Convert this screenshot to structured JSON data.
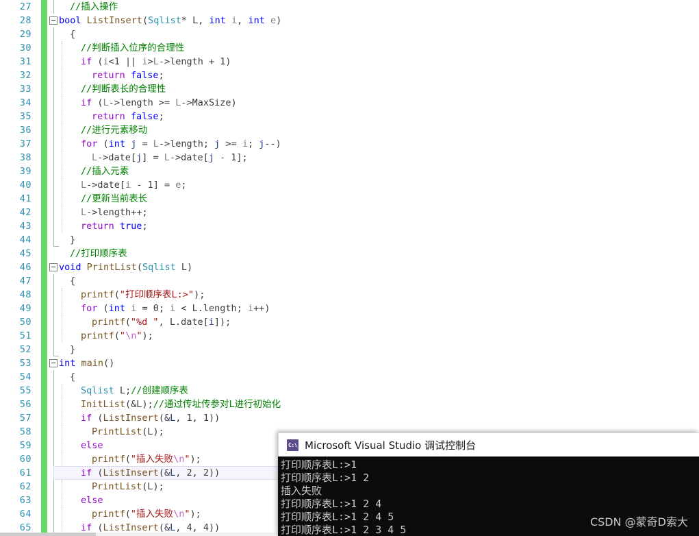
{
  "editor": {
    "first_line_number": 27,
    "current_line_number": 61,
    "colors": {
      "keyword": "#0000ff",
      "control_keyword": "#8f08c4",
      "type": "#2b91af",
      "function": "#74531f",
      "string": "#a31515",
      "escape": "#c660c6",
      "comment": "#008000",
      "line_number": "#2b91af",
      "change_bar": "#69d76a",
      "background": "#ffffff"
    },
    "lines": [
      {
        "n": 27,
        "indent": 1,
        "tokens": [
          {
            "t": "//插入操作",
            "c": "cmt"
          }
        ]
      },
      {
        "n": 28,
        "indent": 0,
        "collapse": true,
        "tokens": [
          {
            "t": "bool",
            "c": "kw"
          },
          {
            "t": " ",
            "c": "plain"
          },
          {
            "t": "ListInsert",
            "c": "fn"
          },
          {
            "t": "(",
            "c": "plain"
          },
          {
            "t": "Sqlist",
            "c": "typ"
          },
          {
            "t": "* L, ",
            "c": "plain"
          },
          {
            "t": "int",
            "c": "kw"
          },
          {
            "t": " ",
            "c": "plain"
          },
          {
            "t": "i",
            "c": "id"
          },
          {
            "t": ", ",
            "c": "plain"
          },
          {
            "t": "int",
            "c": "kw"
          },
          {
            "t": " ",
            "c": "plain"
          },
          {
            "t": "e",
            "c": "id"
          },
          {
            "t": ")",
            "c": "plain"
          }
        ]
      },
      {
        "n": 29,
        "indent": 1,
        "tokens": [
          {
            "t": "{",
            "c": "plain"
          }
        ]
      },
      {
        "n": 30,
        "indent": 2,
        "tokens": [
          {
            "t": "//判断插入位序的合理性",
            "c": "cmt"
          }
        ]
      },
      {
        "n": 31,
        "indent": 2,
        "tokens": [
          {
            "t": "if",
            "c": "kwctl"
          },
          {
            "t": " (",
            "c": "plain"
          },
          {
            "t": "i",
            "c": "id"
          },
          {
            "t": "<1 || ",
            "c": "plain"
          },
          {
            "t": "i",
            "c": "id"
          },
          {
            "t": ">",
            "c": "plain"
          },
          {
            "t": "L",
            "c": "id"
          },
          {
            "t": "->",
            "c": "plain"
          },
          {
            "t": "length",
            "c": "plain"
          },
          {
            "t": " + 1)",
            "c": "plain"
          }
        ]
      },
      {
        "n": 32,
        "indent": 3,
        "tokens": [
          {
            "t": "return",
            "c": "kwctl"
          },
          {
            "t": " ",
            "c": "plain"
          },
          {
            "t": "false",
            "c": "kw"
          },
          {
            "t": ";",
            "c": "plain"
          }
        ]
      },
      {
        "n": 33,
        "indent": 2,
        "tokens": [
          {
            "t": "//判断表长的合理性",
            "c": "cmt"
          }
        ]
      },
      {
        "n": 34,
        "indent": 2,
        "tokens": [
          {
            "t": "if",
            "c": "kwctl"
          },
          {
            "t": " (",
            "c": "plain"
          },
          {
            "t": "L",
            "c": "id"
          },
          {
            "t": "->",
            "c": "plain"
          },
          {
            "t": "length",
            "c": "plain"
          },
          {
            "t": " >= ",
            "c": "plain"
          },
          {
            "t": "L",
            "c": "id"
          },
          {
            "t": "->",
            "c": "plain"
          },
          {
            "t": "MaxSize",
            "c": "plain"
          },
          {
            "t": ")",
            "c": "plain"
          }
        ]
      },
      {
        "n": 35,
        "indent": 3,
        "tokens": [
          {
            "t": "return",
            "c": "kwctl"
          },
          {
            "t": " ",
            "c": "plain"
          },
          {
            "t": "false",
            "c": "kw"
          },
          {
            "t": ";",
            "c": "plain"
          }
        ]
      },
      {
        "n": 36,
        "indent": 2,
        "tokens": [
          {
            "t": "//进行元素移动",
            "c": "cmt"
          }
        ]
      },
      {
        "n": 37,
        "indent": 2,
        "tokens": [
          {
            "t": "for",
            "c": "kwctl"
          },
          {
            "t": " (",
            "c": "plain"
          },
          {
            "t": "int",
            "c": "kw"
          },
          {
            "t": " ",
            "c": "plain"
          },
          {
            "t": "j",
            "c": "idx"
          },
          {
            "t": " = ",
            "c": "plain"
          },
          {
            "t": "L",
            "c": "id"
          },
          {
            "t": "->",
            "c": "plain"
          },
          {
            "t": "length",
            "c": "plain"
          },
          {
            "t": "; ",
            "c": "plain"
          },
          {
            "t": "j",
            "c": "idx"
          },
          {
            "t": " >= ",
            "c": "plain"
          },
          {
            "t": "i",
            "c": "id"
          },
          {
            "t": "; ",
            "c": "plain"
          },
          {
            "t": "j",
            "c": "idx"
          },
          {
            "t": "--)",
            "c": "plain"
          }
        ]
      },
      {
        "n": 38,
        "indent": 3,
        "tokens": [
          {
            "t": "L",
            "c": "id"
          },
          {
            "t": "->",
            "c": "plain"
          },
          {
            "t": "date",
            "c": "plain"
          },
          {
            "t": "[",
            "c": "plain"
          },
          {
            "t": "j",
            "c": "idx"
          },
          {
            "t": "] = ",
            "c": "plain"
          },
          {
            "t": "L",
            "c": "id"
          },
          {
            "t": "->",
            "c": "plain"
          },
          {
            "t": "date",
            "c": "plain"
          },
          {
            "t": "[",
            "c": "plain"
          },
          {
            "t": "j",
            "c": "idx"
          },
          {
            "t": " - 1];",
            "c": "plain"
          }
        ]
      },
      {
        "n": 39,
        "indent": 2,
        "tokens": [
          {
            "t": "//插入元素",
            "c": "cmt"
          }
        ]
      },
      {
        "n": 40,
        "indent": 2,
        "tokens": [
          {
            "t": "L",
            "c": "id"
          },
          {
            "t": "->",
            "c": "plain"
          },
          {
            "t": "date",
            "c": "plain"
          },
          {
            "t": "[",
            "c": "plain"
          },
          {
            "t": "i",
            "c": "id"
          },
          {
            "t": " - 1] = ",
            "c": "plain"
          },
          {
            "t": "e",
            "c": "id"
          },
          {
            "t": ";",
            "c": "plain"
          }
        ]
      },
      {
        "n": 41,
        "indent": 2,
        "tokens": [
          {
            "t": "//更新当前表长",
            "c": "cmt"
          }
        ]
      },
      {
        "n": 42,
        "indent": 2,
        "tokens": [
          {
            "t": "L",
            "c": "id"
          },
          {
            "t": "->",
            "c": "plain"
          },
          {
            "t": "length",
            "c": "plain"
          },
          {
            "t": "++;",
            "c": "plain"
          }
        ]
      },
      {
        "n": 43,
        "indent": 2,
        "tokens": [
          {
            "t": "return",
            "c": "kwctl"
          },
          {
            "t": " ",
            "c": "plain"
          },
          {
            "t": "true",
            "c": "kw"
          },
          {
            "t": ";",
            "c": "plain"
          }
        ]
      },
      {
        "n": 44,
        "indent": 1,
        "tokens": [
          {
            "t": "}",
            "c": "plain"
          }
        ]
      },
      {
        "n": 45,
        "indent": 1,
        "tokens": [
          {
            "t": "//打印顺序表",
            "c": "cmt"
          }
        ]
      },
      {
        "n": 46,
        "indent": 0,
        "collapse": true,
        "tokens": [
          {
            "t": "void",
            "c": "kw"
          },
          {
            "t": " ",
            "c": "plain"
          },
          {
            "t": "PrintList",
            "c": "fn"
          },
          {
            "t": "(",
            "c": "plain"
          },
          {
            "t": "Sqlist",
            "c": "typ"
          },
          {
            "t": " ",
            "c": "plain"
          },
          {
            "t": "L",
            "c": "plain"
          },
          {
            "t": ")",
            "c": "plain"
          }
        ]
      },
      {
        "n": 47,
        "indent": 1,
        "tokens": [
          {
            "t": "{",
            "c": "plain"
          }
        ]
      },
      {
        "n": 48,
        "indent": 2,
        "tokens": [
          {
            "t": "printf",
            "c": "fn"
          },
          {
            "t": "(",
            "c": "plain"
          },
          {
            "t": "\"打印顺序表L:>\"",
            "c": "str"
          },
          {
            "t": ");",
            "c": "plain"
          }
        ]
      },
      {
        "n": 49,
        "indent": 2,
        "tokens": [
          {
            "t": "for",
            "c": "kwctl"
          },
          {
            "t": " (",
            "c": "plain"
          },
          {
            "t": "int",
            "c": "kw"
          },
          {
            "t": " ",
            "c": "plain"
          },
          {
            "t": "i",
            "c": "id"
          },
          {
            "t": " = 0; ",
            "c": "plain"
          },
          {
            "t": "i",
            "c": "id"
          },
          {
            "t": " < ",
            "c": "plain"
          },
          {
            "t": "L",
            "c": "plain"
          },
          {
            "t": ".",
            "c": "plain"
          },
          {
            "t": "length",
            "c": "plain"
          },
          {
            "t": "; ",
            "c": "plain"
          },
          {
            "t": "i",
            "c": "id"
          },
          {
            "t": "++)",
            "c": "plain"
          }
        ]
      },
      {
        "n": 50,
        "indent": 3,
        "tokens": [
          {
            "t": "printf",
            "c": "fn"
          },
          {
            "t": "(",
            "c": "plain"
          },
          {
            "t": "\"%d \"",
            "c": "str"
          },
          {
            "t": ", ",
            "c": "plain"
          },
          {
            "t": "L",
            "c": "plain"
          },
          {
            "t": ".",
            "c": "plain"
          },
          {
            "t": "date",
            "c": "plain"
          },
          {
            "t": "[",
            "c": "plain"
          },
          {
            "t": "i",
            "c": "idx"
          },
          {
            "t": "]);",
            "c": "plain"
          }
        ]
      },
      {
        "n": 51,
        "indent": 2,
        "tokens": [
          {
            "t": "printf",
            "c": "fn"
          },
          {
            "t": "(",
            "c": "plain"
          },
          {
            "t": "\"",
            "c": "str"
          },
          {
            "t": "\\n",
            "c": "esc"
          },
          {
            "t": "\"",
            "c": "str"
          },
          {
            "t": ");",
            "c": "plain"
          }
        ]
      },
      {
        "n": 52,
        "indent": 1,
        "tokens": [
          {
            "t": "}",
            "c": "plain"
          }
        ]
      },
      {
        "n": 53,
        "indent": 0,
        "collapse": true,
        "tokens": [
          {
            "t": "int",
            "c": "kw"
          },
          {
            "t": " ",
            "c": "plain"
          },
          {
            "t": "main",
            "c": "fn"
          },
          {
            "t": "()",
            "c": "plain"
          }
        ]
      },
      {
        "n": 54,
        "indent": 1,
        "tokens": [
          {
            "t": "{",
            "c": "plain"
          }
        ]
      },
      {
        "n": 55,
        "indent": 2,
        "tokens": [
          {
            "t": "Sqlist",
            "c": "typ"
          },
          {
            "t": " ",
            "c": "plain"
          },
          {
            "t": "L",
            "c": "plain"
          },
          {
            "t": ";",
            "c": "plain"
          },
          {
            "t": "//创建顺序表",
            "c": "cmt"
          }
        ]
      },
      {
        "n": 56,
        "indent": 2,
        "tokens": [
          {
            "t": "InitList",
            "c": "fn"
          },
          {
            "t": "(&",
            "c": "plain"
          },
          {
            "t": "L",
            "c": "plain"
          },
          {
            "t": ");",
            "c": "plain"
          },
          {
            "t": "//通过传址传参对L进行初始化",
            "c": "cmt"
          }
        ]
      },
      {
        "n": 57,
        "indent": 2,
        "tokens": [
          {
            "t": "if",
            "c": "kwctl"
          },
          {
            "t": " (",
            "c": "plain"
          },
          {
            "t": "ListInsert",
            "c": "fn"
          },
          {
            "t": "(&",
            "c": "plain"
          },
          {
            "t": "L",
            "c": "idx"
          },
          {
            "t": ", 1, 1))",
            "c": "plain"
          }
        ]
      },
      {
        "n": 58,
        "indent": 3,
        "tokens": [
          {
            "t": "PrintList",
            "c": "fn"
          },
          {
            "t": "(",
            "c": "plain"
          },
          {
            "t": "L",
            "c": "plain"
          },
          {
            "t": ");",
            "c": "plain"
          }
        ]
      },
      {
        "n": 59,
        "indent": 2,
        "tokens": [
          {
            "t": "else",
            "c": "kwctl"
          }
        ]
      },
      {
        "n": 60,
        "indent": 3,
        "tokens": [
          {
            "t": "printf",
            "c": "fn"
          },
          {
            "t": "(",
            "c": "plain"
          },
          {
            "t": "\"插入失败",
            "c": "str"
          },
          {
            "t": "\\n",
            "c": "esc"
          },
          {
            "t": "\"",
            "c": "str"
          },
          {
            "t": ");",
            "c": "plain"
          }
        ]
      },
      {
        "n": 61,
        "indent": 2,
        "current": true,
        "tokens": [
          {
            "t": "if",
            "c": "kwctl"
          },
          {
            "t": " (",
            "c": "plain"
          },
          {
            "t": "ListInsert",
            "c": "fn"
          },
          {
            "t": "(&",
            "c": "plain"
          },
          {
            "t": "L",
            "c": "idx"
          },
          {
            "t": ", 2, 2))",
            "c": "plain"
          }
        ]
      },
      {
        "n": 62,
        "indent": 3,
        "tokens": [
          {
            "t": "PrintList",
            "c": "fn"
          },
          {
            "t": "(",
            "c": "plain"
          },
          {
            "t": "L",
            "c": "plain"
          },
          {
            "t": ");",
            "c": "plain"
          }
        ]
      },
      {
        "n": 63,
        "indent": 2,
        "tokens": [
          {
            "t": "else",
            "c": "kwctl"
          }
        ]
      },
      {
        "n": 64,
        "indent": 3,
        "tokens": [
          {
            "t": "printf",
            "c": "fn"
          },
          {
            "t": "(",
            "c": "plain"
          },
          {
            "t": "\"插入失败",
            "c": "str"
          },
          {
            "t": "\\n",
            "c": "esc"
          },
          {
            "t": "\"",
            "c": "str"
          },
          {
            "t": ");",
            "c": "plain"
          }
        ]
      },
      {
        "n": 65,
        "indent": 2,
        "tokens": [
          {
            "t": "if",
            "c": "kwctl"
          },
          {
            "t": " (",
            "c": "plain"
          },
          {
            "t": "ListInsert",
            "c": "fn"
          },
          {
            "t": "(&",
            "c": "plain"
          },
          {
            "t": "L",
            "c": "idx"
          },
          {
            "t": ", 4, 4))",
            "c": "plain"
          }
        ]
      }
    ]
  },
  "console": {
    "icon": "console-app-icon",
    "icon_glyph": "C:\\",
    "title": "Microsoft Visual Studio 调试控制台",
    "output": [
      "打印顺序表L:>1",
      "打印顺序表L:>1 2",
      "插入失败",
      "打印顺序表L:>1 2 4",
      "打印顺序表L:>1 2 4 5",
      "打印顺序表L:>1 2 3 4 5"
    ],
    "watermark": "CSDN @蒙奇D索大"
  }
}
